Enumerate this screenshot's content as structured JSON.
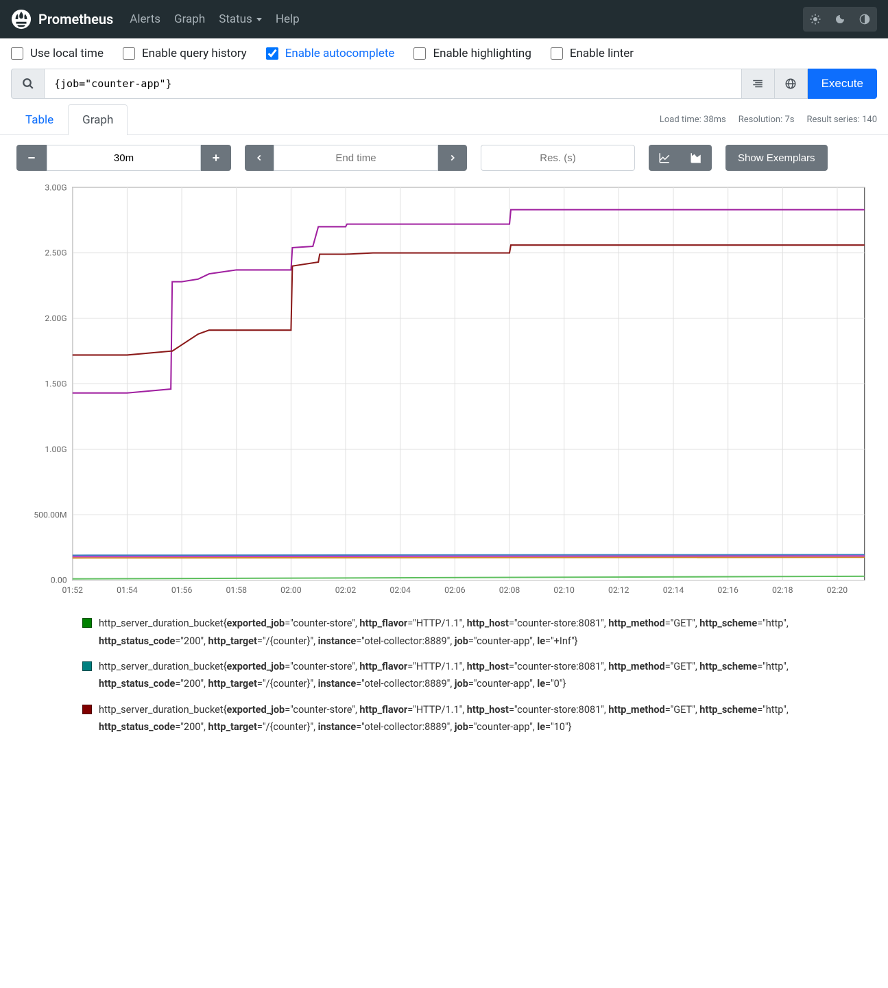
{
  "nav": {
    "brand": "Prometheus",
    "links": [
      "Alerts",
      "Graph",
      "Status",
      "Help"
    ]
  },
  "options": [
    {
      "label": "Use local time",
      "checked": false
    },
    {
      "label": "Enable query history",
      "checked": false
    },
    {
      "label": "Enable autocomplete",
      "checked": true
    },
    {
      "label": "Enable highlighting",
      "checked": false
    },
    {
      "label": "Enable linter",
      "checked": false
    }
  ],
  "query": {
    "value": "{job=\"counter-app\"}",
    "execute": "Execute"
  },
  "tabs": {
    "table": "Table",
    "graph": "Graph"
  },
  "stats": {
    "load": "Load time: 38ms",
    "res": "Resolution: 7s",
    "series": "Result series: 140"
  },
  "controls": {
    "range": "30m",
    "endtime_placeholder": "End time",
    "res_placeholder": "Res. (s)",
    "exemplars": "Show Exemplars"
  },
  "chart_data": {
    "type": "line",
    "xlabel": "",
    "ylabel": "",
    "x_ticks": [
      "01:52",
      "01:54",
      "01:56",
      "01:58",
      "02:00",
      "02:02",
      "02:04",
      "02:06",
      "02:08",
      "02:10",
      "02:12",
      "02:14",
      "02:16",
      "02:18",
      "02:20"
    ],
    "y_ticks": [
      "0.00",
      "500.00M",
      "1.00G",
      "1.50G",
      "2.00G",
      "2.50G",
      "3.00G"
    ],
    "ylim": [
      0,
      3000000000.0
    ],
    "series": [
      {
        "name": "purple",
        "color": "#a020a0",
        "x": [
          0,
          2,
          3.6,
          3.65,
          4,
          4.6,
          5,
          6,
          8,
          8.05,
          8.8,
          9,
          10,
          10.05,
          11,
          16,
          16.05,
          29
        ],
        "values": [
          1430000000.0,
          1430000000.0,
          1460000000.0,
          2280000000.0,
          2280000000.0,
          2300000000.0,
          2340000000.0,
          2370000000.0,
          2370000000.0,
          2540000000.0,
          2550000000.0,
          2700000000.0,
          2700000000.0,
          2720000000.0,
          2720000000.0,
          2720000000.0,
          2830000000.0,
          2830000000.0
        ]
      },
      {
        "name": "darkred",
        "color": "#8b1a1a",
        "x": [
          0,
          2,
          3.6,
          3.65,
          4.6,
          5,
          6,
          8,
          8.05,
          9,
          9.05,
          10,
          11,
          16,
          16.05,
          29
        ],
        "values": [
          1720000000.0,
          1720000000.0,
          1750000000.0,
          1750000000.0,
          1880000000.0,
          1910000000.0,
          1910000000.0,
          1910000000.0,
          2400000000.0,
          2430000000.0,
          2490000000.0,
          2490000000.0,
          2500000000.0,
          2500000000.0,
          2560000000.0,
          2560000000.0
        ]
      },
      {
        "name": "low-blue",
        "color": "#3f7fbf",
        "x": [
          0,
          29
        ],
        "values": [
          190000000.0,
          195000000.0
        ]
      },
      {
        "name": "low-orange",
        "color": "#d08a2a",
        "x": [
          0,
          29
        ],
        "values": [
          170000000.0,
          175000000.0
        ]
      },
      {
        "name": "low-magenta",
        "color": "#c040c0",
        "x": [
          0,
          29
        ],
        "values": [
          180000000.0,
          185000000.0
        ]
      },
      {
        "name": "near-zero",
        "color": "#60c060",
        "x": [
          0,
          29
        ],
        "values": [
          10000000.0,
          30000000.0
        ]
      }
    ]
  },
  "legend": [
    {
      "color": "#008000",
      "metric": "http_server_duration_bucket",
      "labels": {
        "exported_job": "counter-store",
        "http_flavor": "HTTP/1.1",
        "http_host": "counter-store:8081",
        "http_method": "GET",
        "http_scheme": "http",
        "http_status_code": "200",
        "http_target": "/{counter}",
        "instance": "otel-collector:8889",
        "job": "counter-app",
        "le": "+Inf"
      }
    },
    {
      "color": "#008080",
      "metric": "http_server_duration_bucket",
      "labels": {
        "exported_job": "counter-store",
        "http_flavor": "HTTP/1.1",
        "http_host": "counter-store:8081",
        "http_method": "GET",
        "http_scheme": "http",
        "http_status_code": "200",
        "http_target": "/{counter}",
        "instance": "otel-collector:8889",
        "job": "counter-app",
        "le": "0"
      }
    },
    {
      "color": "#800000",
      "metric": "http_server_duration_bucket",
      "labels": {
        "exported_job": "counter-store",
        "http_flavor": "HTTP/1.1",
        "http_host": "counter-store:8081",
        "http_method": "GET",
        "http_scheme": "http",
        "http_status_code": "200",
        "http_target": "/{counter}",
        "instance": "otel-collector:8889",
        "job": "counter-app",
        "le": "10"
      }
    }
  ]
}
